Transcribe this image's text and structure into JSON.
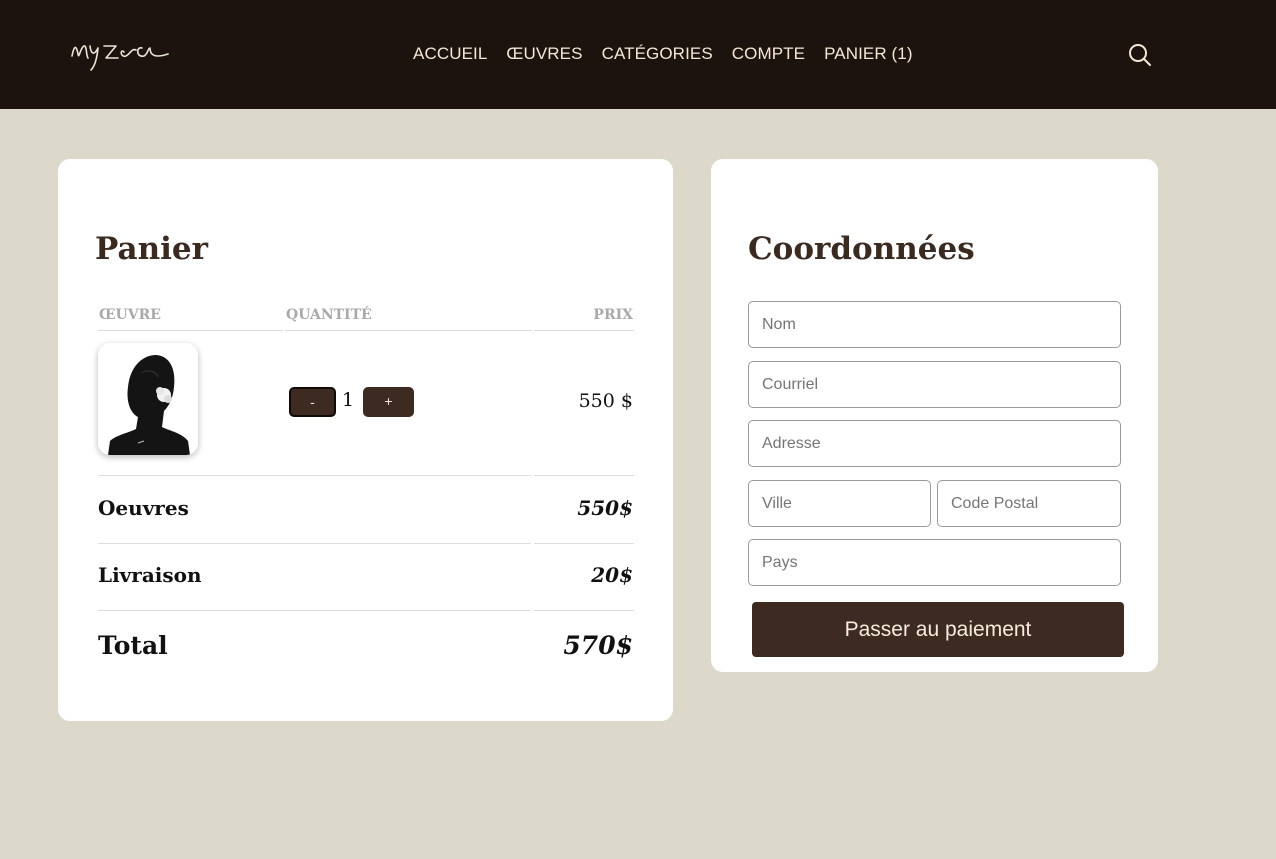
{
  "header": {
    "logo_text": "myzea",
    "nav": [
      "ACCUEIL",
      "ŒUVRES",
      "CATÉGORIES",
      "COMPTE",
      "PANIER (1)"
    ]
  },
  "cart": {
    "title": "Panier",
    "columns": {
      "oeuvre": "ŒUVRE",
      "quantite": "QUANTITÉ",
      "prix": "PRIX"
    },
    "items": [
      {
        "quantity": "1",
        "price": "550 $",
        "minus_label": "-",
        "plus_label": "+"
      }
    ],
    "summary": {
      "oeuvres_label": "Oeuvres",
      "oeuvres_value": "550$",
      "livraison_label": "Livraison",
      "livraison_value": "20$",
      "total_label": "Total",
      "total_value": "570$"
    }
  },
  "form": {
    "title": "Coordonnées",
    "placeholders": {
      "nom": "Nom",
      "courriel": "Courriel",
      "adresse": "Adresse",
      "ville": "Ville",
      "code_postal": "Code Postal",
      "pays": "Pays"
    },
    "submit_label": "Passer au paiement"
  },
  "colors": {
    "header_bg": "#1c130e",
    "page_bg": "#dcd9ca",
    "accent": "#3d2a20",
    "nav_text": "#f3e8d6"
  }
}
